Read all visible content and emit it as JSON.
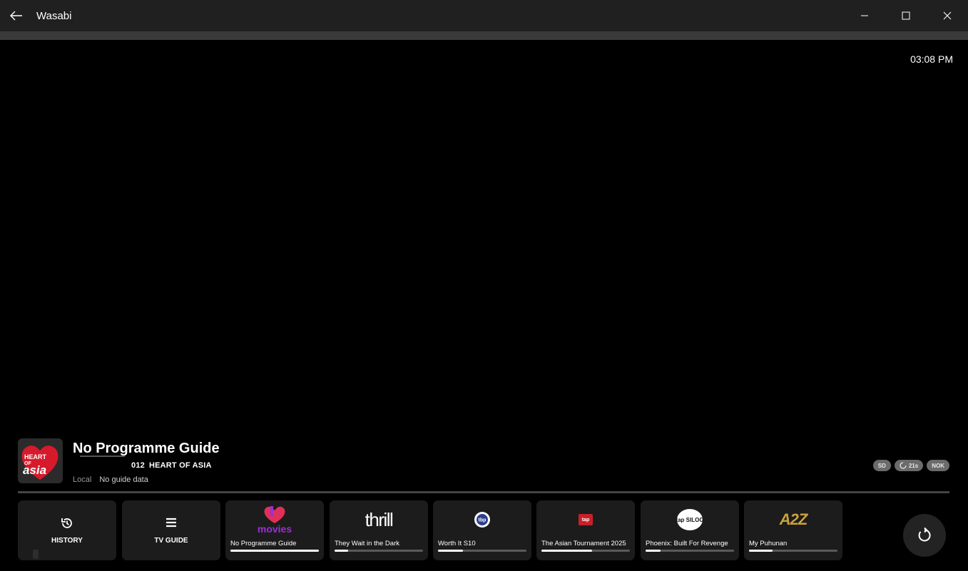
{
  "window": {
    "title": "Wasabi"
  },
  "clock": "03:08 PM",
  "now_playing": {
    "logo_lines": [
      "HEART",
      "OF",
      "asia"
    ],
    "title": "No Programme Guide",
    "channel_number": "012",
    "channel_name": "HEART OF ASIA",
    "source": "Local",
    "guide_status": "No guide data",
    "badges": {
      "quality": "SD",
      "buffer": "21s",
      "status": "NOK"
    }
  },
  "actions": [
    {
      "label": "HISTORY",
      "icon": "history-icon"
    },
    {
      "label": "TV GUIDE",
      "icon": "menu-icon"
    }
  ],
  "channels": [
    {
      "logo_text": "movies",
      "logo_icon": "heart-logo",
      "label": "No Programme Guide",
      "progress": 1.0
    },
    {
      "logo_text": "thrill",
      "label": "They Wait in the Dark",
      "progress": 0.15
    },
    {
      "logo_text": "tbp",
      "label": "Worth It S10",
      "progress": 0.28
    },
    {
      "logo_text": "tap",
      "label": "The Asian Tournament 2025",
      "progress": 0.57
    },
    {
      "logo_text": "tap SILOG",
      "label": "Phoenix: Built For Revenge",
      "progress": 0.17
    },
    {
      "logo_text": "A2Z",
      "label": "My Puhunan",
      "progress": 0.27
    }
  ],
  "colors": {
    "heart_red": "#d61a2b",
    "movies_purple": "#9b2fd6",
    "a2z_gold": "#c9a23a"
  }
}
